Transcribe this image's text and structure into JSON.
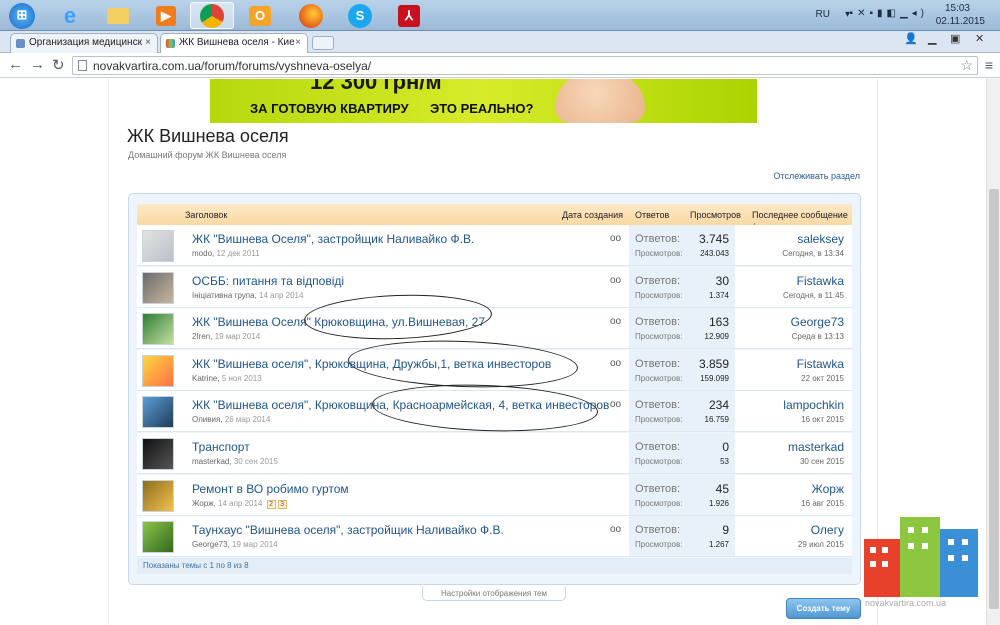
{
  "taskbar": {
    "start_label": "Start",
    "apps": [
      {
        "icon": "ie-icon"
      },
      {
        "icon": "folder-icon"
      },
      {
        "icon": "media-player-icon"
      },
      {
        "icon": "chrome-icon"
      },
      {
        "icon": "outlook-icon"
      },
      {
        "icon": "firefox-icon"
      },
      {
        "icon": "skype-icon"
      },
      {
        "icon": "adobe-reader-icon"
      }
    ],
    "lang": "RU",
    "time": "15:03",
    "date": "02.11.2015"
  },
  "browser": {
    "tabs": [
      {
        "label": "Организация медицинск",
        "active": false
      },
      {
        "label": "ЖК Вишнева оселя - Кие",
        "active": true
      }
    ],
    "url": "novakvartira.com.ua/forum/forums/vyshneva-oselya/"
  },
  "banner": {
    "price_text": "12 300 грн/м",
    "left_text": "ЗА ГОТОВУЮ КВАРТИРУ",
    "right_text": "ЭТО РЕАЛЬНО?"
  },
  "forum": {
    "title": "ЖК Вишнева оселя",
    "subtitle": "Домашний форум ЖК Вишнева оселя",
    "watch_label": "Отслеживать раздел",
    "columns": {
      "title": "Заголовок",
      "date": "Дата создания",
      "replies": "Ответов",
      "views": "Просмотров",
      "last": "Последнее сообщение ↓"
    },
    "threads": [
      {
        "title": "ЖК \"Вишнева Оселя\", застройщик Наливайко Ф.В.",
        "author": "modo",
        "date": "12 дек 2011",
        "replies_label": "Ответов:",
        "replies": "3.745",
        "views_label": "Просмотров:",
        "views": "243.043",
        "last_user": "saleksey",
        "last_date": "Сегодня, в 13:34",
        "glasses": true
      },
      {
        "title": "ОСББ: питання та відповіді",
        "author": "Ініціативна група",
        "date": "14 апр 2014",
        "replies_label": "Ответов:",
        "replies": "30",
        "views_label": "Просмотров:",
        "views": "1.374",
        "last_user": "Fistawka",
        "last_date": "Сегодня, в 11:45",
        "glasses": true
      },
      {
        "title": "ЖК \"Вишнева Оселя\" Крюковщина, ул.Вишневая, 27",
        "author": "2Iren",
        "date": "19 мар 2014",
        "replies_label": "Ответов:",
        "replies": "163",
        "views_label": "Просмотров:",
        "views": "12.909",
        "last_user": "George73",
        "last_date": "Среда в 13:13",
        "glasses": true
      },
      {
        "title": "ЖК \"Вишнева оселя\", Крюковщина, Дружбы,1, ветка инвесторов",
        "author": "Katrine",
        "date": "5 ноя 2013",
        "replies_label": "Ответов:",
        "replies": "3.859",
        "views_label": "Просмотров:",
        "views": "159.099",
        "last_user": "Fistawka",
        "last_date": "22 окт 2015",
        "glasses": true
      },
      {
        "title": "ЖК \"Вишнева оселя\", Крюковщина, Красноармейская, 4, ветка инвесторов",
        "author": "Оливия",
        "date": "26 мар 2014",
        "replies_label": "Ответов:",
        "replies": "234",
        "views_label": "Просмотров:",
        "views": "16.759",
        "last_user": "lampochkin",
        "last_date": "16 окт 2015",
        "glasses": true
      },
      {
        "title": "Транспорт",
        "author": "masterkad",
        "date": "30 сен 2015",
        "replies_label": "Ответов:",
        "replies": "0",
        "views_label": "Просмотров:",
        "views": "53",
        "last_user": "masterkad",
        "last_date": "30 сен 2015",
        "glasses": false
      },
      {
        "title": "Ремонт в ВО робимо гуртом",
        "author": "Жорж",
        "date": "14 апр 2014",
        "pages": [
          "2",
          "3"
        ],
        "replies_label": "Ответов:",
        "replies": "45",
        "views_label": "Просмотров:",
        "views": "1.926",
        "last_user": "Жорж",
        "last_date": "16 авг 2015",
        "glasses": false
      },
      {
        "title": "Таунхаус \"Вишнева оселя\", застройщик Наливайко Ф.В.",
        "author": "George73",
        "date": "19 мар 2014",
        "replies_label": "Ответов:",
        "replies": "9",
        "views_label": "Просмотров:",
        "views": "1.267",
        "last_user": "Олегу",
        "last_date": "29 июл 2015",
        "glasses": true
      }
    ],
    "footer": "Показаны темы с 1 по 8 из 8",
    "display_settings": "Настройки отображения тем",
    "create_label": "Создать тему"
  },
  "logo_text": "novakvartira.com.ua"
}
